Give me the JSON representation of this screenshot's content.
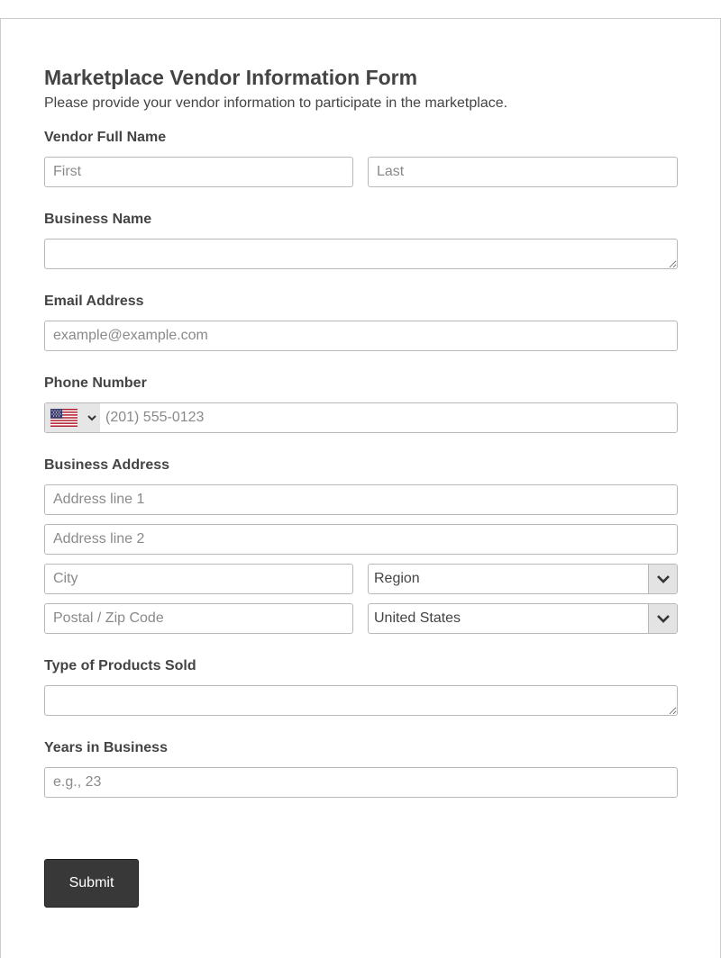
{
  "form": {
    "title": "Marketplace Vendor Information Form",
    "subtitle": "Please provide your vendor information to participate in the marketplace."
  },
  "vendor_name": {
    "label": "Vendor Full Name",
    "first_placeholder": "First",
    "last_placeholder": "Last",
    "first_value": "",
    "last_value": ""
  },
  "business_name": {
    "label": "Business Name",
    "value": ""
  },
  "email": {
    "label": "Email Address",
    "placeholder": "example@example.com",
    "value": ""
  },
  "phone": {
    "label": "Phone Number",
    "country_flag": "us-flag-icon",
    "placeholder": "(201) 555-0123",
    "value": ""
  },
  "address": {
    "label": "Business Address",
    "line1_placeholder": "Address line 1",
    "line2_placeholder": "Address line 2",
    "city_placeholder": "City",
    "region_selected": "Region",
    "postal_placeholder": "Postal / Zip Code",
    "country_selected": "United States"
  },
  "products": {
    "label": "Type of Products Sold",
    "value": ""
  },
  "years": {
    "label": "Years in Business",
    "placeholder": "e.g., 23",
    "value": ""
  },
  "submit": {
    "label": "Submit"
  },
  "colors": {
    "button_bg": "#383838",
    "border": "#b8b8b8",
    "text": "#444444",
    "placeholder": "#8a8a8a"
  }
}
